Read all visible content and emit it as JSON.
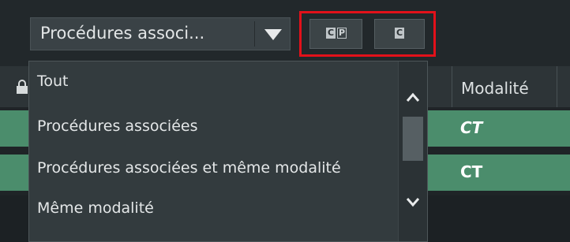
{
  "filter": {
    "selected": "Procédures associ...",
    "options": [
      "Tout",
      "Procédures associées",
      "Procédures associées et même modalité",
      "Même modalité"
    ]
  },
  "toolbar": {
    "btn_cp_left": "C",
    "btn_cp_right": "P",
    "btn_c": "C"
  },
  "table": {
    "header_modalite": "Modalité",
    "rows": [
      {
        "modalite": "CT"
      },
      {
        "modalite": "CT"
      }
    ]
  },
  "colors": {
    "accent_row": "#4b8d6c",
    "highlight_box": "#e2111a"
  }
}
